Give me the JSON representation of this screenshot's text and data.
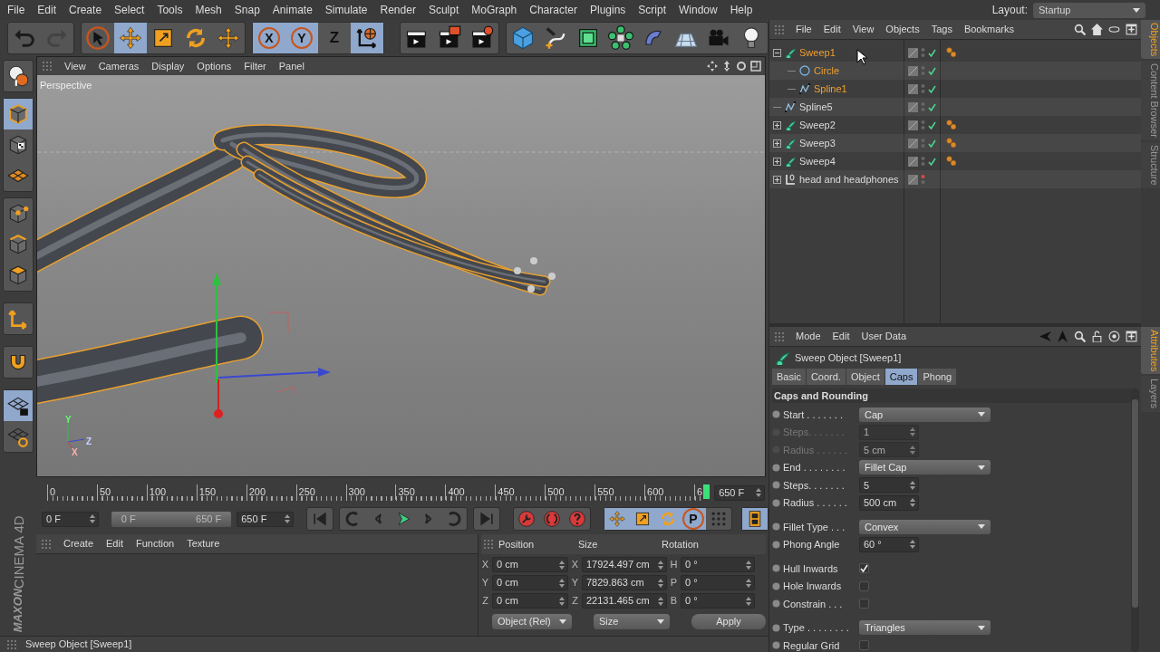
{
  "menu": [
    "File",
    "Edit",
    "Create",
    "Select",
    "Tools",
    "Mesh",
    "Snap",
    "Animate",
    "Simulate",
    "Render",
    "Sculpt",
    "MoGraph",
    "Character",
    "Plugins",
    "Script",
    "Window",
    "Help"
  ],
  "layout": {
    "label": "Layout:",
    "value": "Startup"
  },
  "toolbar": [
    [
      {
        "kind": "undo",
        "disabled": false
      },
      {
        "kind": "redo",
        "disabled": true
      }
    ],
    [
      {
        "kind": "select",
        "selected": false
      },
      {
        "kind": "move",
        "selected": true
      },
      {
        "kind": "scale",
        "selected": false
      },
      {
        "kind": "rotate",
        "selected": false
      },
      {
        "kind": "cross",
        "selected": false
      }
    ],
    [
      {
        "kind": "axis",
        "label": "X",
        "selected": true
      },
      {
        "kind": "axis",
        "label": "Y",
        "selected": true
      },
      {
        "kind": "letter",
        "label": "Z",
        "selected": false
      },
      {
        "kind": "coord",
        "selected": true
      }
    ],
    [
      {
        "kind": "render-view",
        "selected": false
      },
      {
        "kind": "render-picture",
        "selected": false
      },
      {
        "kind": "render-settings",
        "selected": false
      }
    ],
    [
      {
        "kind": "cube",
        "selected": false
      },
      {
        "kind": "pen",
        "selected": false
      },
      {
        "kind": "subdiv",
        "selected": false
      },
      {
        "kind": "cloner",
        "selected": false
      },
      {
        "kind": "deformer",
        "selected": false
      },
      {
        "kind": "floor",
        "selected": false
      },
      {
        "kind": "camera",
        "selected": false
      },
      {
        "kind": "light",
        "selected": false
      }
    ]
  ],
  "side_toolbar": [
    [
      {
        "kind": "sphere",
        "selected": false
      }
    ],
    [
      {
        "kind": "model",
        "selected": true
      },
      {
        "kind": "texture",
        "selected": false
      },
      {
        "kind": "workplane",
        "selected": false
      }
    ],
    [
      {
        "kind": "points",
        "selected": false
      },
      {
        "kind": "edges",
        "selected": false
      },
      {
        "kind": "polygons",
        "selected": false
      }
    ],
    [
      {
        "kind": "axis-mode",
        "selected": false
      }
    ],
    [
      {
        "kind": "magnet",
        "selected": false
      }
    ],
    [
      {
        "kind": "grid-lock",
        "selected": true
      },
      {
        "kind": "grid-rotate",
        "selected": false
      }
    ]
  ],
  "logo": {
    "brand": "MAXON",
    "product": "CINEMA 4D"
  },
  "viewport": {
    "menu": [
      "View",
      "Cameras",
      "Display",
      "Options",
      "Filter",
      "Panel"
    ],
    "camera": "Perspective",
    "world_axis_labels": [
      "Y",
      "Z",
      "X"
    ]
  },
  "timeline": {
    "labels": [
      "0",
      "50",
      "100",
      "150",
      "200",
      "250",
      "300",
      "350",
      "400",
      "450",
      "500",
      "550",
      "600",
      "6"
    ],
    "level": 1,
    "end_field": "650 F"
  },
  "transport": {
    "start_field": "0 F",
    "range": {
      "start": "0 F",
      "end": "650 F",
      "level": 1
    },
    "end_field": "650 F",
    "groups": [
      [
        {
          "kind": "to-start",
          "selected": false
        }
      ],
      [
        {
          "kind": "loop-back",
          "selected": false
        },
        {
          "kind": "step-back",
          "selected": false
        },
        {
          "kind": "play",
          "selected": false
        },
        {
          "kind": "step-forward",
          "selected": false
        },
        {
          "kind": "loop-forward",
          "selected": false
        }
      ],
      [
        {
          "kind": "to-end",
          "selected": false
        }
      ],
      [
        {
          "kind": "record",
          "selected": false
        },
        {
          "kind": "autokey",
          "selected": false
        },
        {
          "kind": "key-help",
          "selected": false
        }
      ],
      [
        {
          "kind": "move",
          "selected": true
        },
        {
          "kind": "scale",
          "selected": true
        },
        {
          "kind": "rotate",
          "selected": true
        },
        {
          "kind": "axis",
          "label": "P",
          "selected": true
        },
        {
          "kind": "dots",
          "selected": false
        }
      ],
      [
        {
          "kind": "film",
          "selected": true
        }
      ]
    ]
  },
  "materials": {
    "menu": [
      "Create",
      "Edit",
      "Function",
      "Texture"
    ]
  },
  "coordinates": {
    "headers": [
      "Position",
      "Size",
      "Rotation"
    ],
    "rows": [
      {
        "axis": "X",
        "position": "0 cm",
        "size_axis": "X",
        "size": "17924.497 cm",
        "rot_axis": "H",
        "rotation": "0 °"
      },
      {
        "axis": "Y",
        "position": "0 cm",
        "size_axis": "Y",
        "size": "7829.863 cm",
        "rot_axis": "P",
        "rotation": "0 °"
      },
      {
        "axis": "Z",
        "position": "0 cm",
        "size_axis": "Z",
        "size": "22131.465 cm",
        "rot_axis": "B",
        "rotation": "0 °"
      }
    ],
    "mode": "Object (Rel)",
    "size_mode": "Size",
    "apply": "Apply"
  },
  "status_bar": "Sweep Object [Sweep1]",
  "objects": {
    "menu": [
      "File",
      "Edit",
      "View",
      "Objects",
      "Tags",
      "Bookmarks"
    ],
    "items": [
      {
        "name": "Sweep1",
        "kind": "sweep",
        "selected": true,
        "expanded": true,
        "enabled": true,
        "hidden_in_editor": false,
        "material_tag": true,
        "children": [
          {
            "name": "Circle",
            "kind": "circle",
            "selected": true,
            "enabled": true,
            "hidden_in_editor": false,
            "material_tag": false
          },
          {
            "name": "Spline1",
            "kind": "spline",
            "selected": true,
            "enabled": true,
            "hidden_in_editor": false,
            "material_tag": false
          }
        ]
      },
      {
        "name": "Spline5",
        "kind": "spline",
        "selected": false,
        "enabled": true,
        "hidden_in_editor": false,
        "material_tag": false
      },
      {
        "name": "Sweep2",
        "kind": "sweep",
        "selected": false,
        "expanded": false,
        "enabled": true,
        "hidden_in_editor": false,
        "material_tag": true
      },
      {
        "name": "Sweep3",
        "kind": "sweep",
        "selected": false,
        "expanded": false,
        "enabled": true,
        "hidden_in_editor": false,
        "material_tag": true
      },
      {
        "name": "Sweep4",
        "kind": "sweep",
        "selected": false,
        "expanded": false,
        "enabled": true,
        "hidden_in_editor": false,
        "material_tag": true
      },
      {
        "name": "head and headphones",
        "kind": "null",
        "selected": false,
        "expanded": false,
        "enabled": false,
        "hidden_in_editor": true,
        "material_tag": false
      }
    ]
  },
  "side_tabs_top": [
    {
      "label": "Objects",
      "selected": true
    },
    {
      "label": "Content Browser",
      "selected": false
    },
    {
      "label": "Structure",
      "selected": false
    }
  ],
  "side_tabs_bottom": [
    {
      "label": "Attributes",
      "selected": true
    },
    {
      "label": "Layers",
      "selected": false
    }
  ],
  "attributes": {
    "menu": [
      "Mode",
      "Edit",
      "User Data"
    ],
    "title": "Sweep Object [Sweep1]",
    "tabs": [
      {
        "label": "Basic",
        "selected": false
      },
      {
        "label": "Coord.",
        "selected": false
      },
      {
        "label": "Object",
        "selected": false
      },
      {
        "label": "Caps",
        "selected": true
      },
      {
        "label": "Phong",
        "selected": false
      }
    ],
    "section": "Caps and Rounding",
    "groups": [
      [
        {
          "label": "Start . . . . . . .",
          "kind": "dropdown",
          "value": "Cap",
          "disabled": false
        },
        {
          "label": "Steps. . . . . . .",
          "kind": "number",
          "value": "1",
          "disabled": true
        },
        {
          "label": "Radius . . . . . .",
          "kind": "number",
          "value": "5 cm",
          "disabled": true
        },
        {
          "label": "End . . . . . . . .",
          "kind": "dropdown",
          "value": "Fillet Cap",
          "disabled": false
        },
        {
          "label": "Steps. . . . . . .",
          "kind": "number",
          "value": "5",
          "disabled": false
        },
        {
          "label": "Radius . . . . . .",
          "kind": "number",
          "value": "500 cm",
          "disabled": false
        }
      ],
      [
        {
          "label": "Fillet Type . . .",
          "kind": "dropdown",
          "value": "Convex",
          "disabled": false
        },
        {
          "label": "Phong Angle",
          "kind": "number",
          "value": "60 °",
          "disabled": false
        }
      ],
      [
        {
          "label": "Hull Inwards",
          "kind": "checkbox",
          "checked": true,
          "disabled": false
        },
        {
          "label": "Hole Inwards",
          "kind": "checkbox",
          "checked": false,
          "disabled": false
        },
        {
          "label": "Constrain . . .",
          "kind": "checkbox",
          "checked": false,
          "disabled": false
        }
      ],
      [
        {
          "label": "Type . . . . . . . .",
          "kind": "dropdown",
          "value": "Triangles",
          "disabled": false
        },
        {
          "label": "Regular Grid",
          "kind": "checkbox",
          "checked": false,
          "disabled": false
        }
      ]
    ]
  }
}
